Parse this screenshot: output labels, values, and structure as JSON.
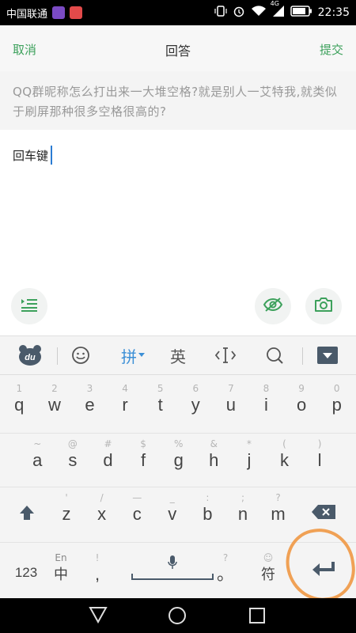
{
  "status_bar": {
    "carrier": "中国联通",
    "network": "4G",
    "time": "22:35",
    "icons": [
      "app-notification-icon",
      "app-notification-icon",
      "vibrate-icon",
      "alarm-icon",
      "wifi-icon",
      "signal-icon",
      "battery-icon"
    ]
  },
  "appbar": {
    "cancel_label": "取消",
    "title": "回答",
    "submit_label": "提交"
  },
  "question": {
    "text": "QQ群昵称怎么打出来一大堆空格?就是别人一艾特我,就类似于刷屏那种很多空格很高的?"
  },
  "answer": {
    "text": "回车键"
  },
  "toolbar": {
    "pinyin_label": "拼",
    "english_label": "英",
    "icons": [
      "du-logo-icon",
      "emoji-icon",
      "cursor-move-icon",
      "search-icon",
      "collapse-keyboard-icon"
    ]
  },
  "keyboard": {
    "row1": [
      {
        "main": "q",
        "hint": "1"
      },
      {
        "main": "w",
        "hint": "2"
      },
      {
        "main": "e",
        "hint": "3"
      },
      {
        "main": "r",
        "hint": "4"
      },
      {
        "main": "t",
        "hint": "5"
      },
      {
        "main": "y",
        "hint": "6"
      },
      {
        "main": "u",
        "hint": "7"
      },
      {
        "main": "i",
        "hint": "8"
      },
      {
        "main": "o",
        "hint": "9"
      },
      {
        "main": "p",
        "hint": "0"
      }
    ],
    "row2": [
      {
        "main": "a",
        "hint": "~"
      },
      {
        "main": "s",
        "hint": "@"
      },
      {
        "main": "d",
        "hint": "#"
      },
      {
        "main": "f",
        "hint": "$"
      },
      {
        "main": "g",
        "hint": "%"
      },
      {
        "main": "h",
        "hint": "&"
      },
      {
        "main": "j",
        "hint": "*"
      },
      {
        "main": "k",
        "hint": "("
      },
      {
        "main": "l",
        "hint": ")"
      }
    ],
    "row3": [
      {
        "main": "z",
        "hint": "'"
      },
      {
        "main": "x",
        "hint": "/"
      },
      {
        "main": "c",
        "hint": "—"
      },
      {
        "main": "v",
        "hint": "_"
      },
      {
        "main": "b",
        "hint": ":"
      },
      {
        "main": "n",
        "hint": ";"
      },
      {
        "main": "m",
        "hint": "?"
      }
    ],
    "row4": {
      "num_label": "123",
      "lang_hint": "En",
      "lang_label": "中",
      "comma_hint": "!",
      "comma_label": ",",
      "period_hint": "?",
      "period_label": "。",
      "symbol_hint": "☺",
      "symbol_label": "符"
    }
  },
  "colors": {
    "accent": "#3da15c",
    "caret": "#2b7cd3",
    "annotation": "#f0a155",
    "pinyin": "#3b8fd6"
  }
}
